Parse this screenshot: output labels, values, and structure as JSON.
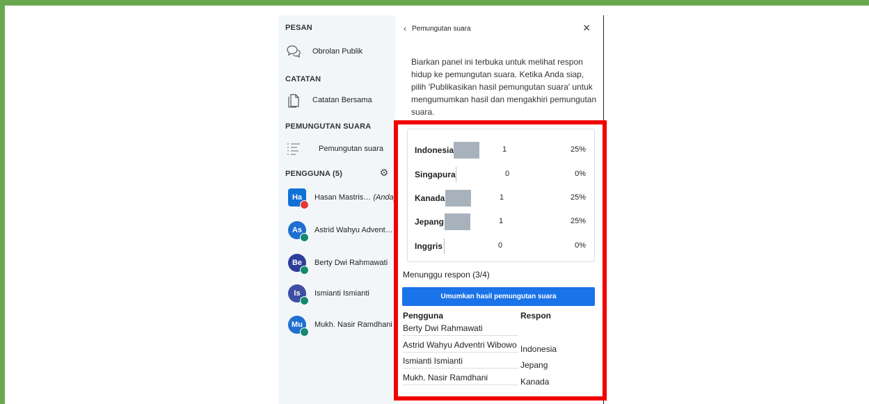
{
  "sidebar": {
    "messages_title": "PESAN",
    "public_chat": "Obrolan Publik",
    "notes_title": "CATATAN",
    "shared_notes": "Catatan Bersama",
    "polling_title": "PEMUNGUTAN SUARA",
    "polling_item": "Pemungutan suara",
    "users_title": "PENGGUNA (5)",
    "users": [
      {
        "initials": "Ha",
        "name": "Hasan Mastris…",
        "suffix": "(Anda)",
        "color": "#0f70d7"
      },
      {
        "initials": "As",
        "name": "Astrid Wahyu Advent…",
        "suffix": "",
        "color": "#1f6fd1"
      },
      {
        "initials": "Be",
        "name": "Berty Dwi Rahmawati",
        "suffix": "",
        "color": "#2c3e9a"
      },
      {
        "initials": "Is",
        "name": "Ismianti Ismianti",
        "suffix": "",
        "color": "#3d4ea3"
      },
      {
        "initials": "Mu",
        "name": "Mukh. Nasir Ramdhani",
        "suffix": "",
        "color": "#1f6fd1"
      }
    ]
  },
  "panel": {
    "back_label": "Pemungutan suara",
    "description": "Biarkan panel ini terbuka untuk melihat respon hidup ke pemungutan suara. Ketika Anda siap, pilih 'Publikasikan hasil pemungutan suara' untuk mengumumkan hasil dan mengakhiri pemungutan suara.",
    "waiting": "Menunggu respon (3/4)",
    "publish_button": "Umumkan hasil pemungutan suara",
    "table_headers": {
      "user": "Pengguna",
      "response": "Respon"
    },
    "responses": [
      {
        "user": "Berty Dwi Rahmawati",
        "response": ""
      },
      {
        "user": "Astrid Wahyu Adventri Wibowo",
        "response": "Indonesia"
      },
      {
        "user": "Ismianti Ismianti",
        "response": "Jepang"
      },
      {
        "user": "Mukh. Nasir Ramdhani",
        "response": "Kanada"
      }
    ]
  },
  "results": [
    {
      "option": "Indonesia",
      "count": "1",
      "percent": "25%",
      "share": 0.25
    },
    {
      "option": "Singapura",
      "count": "0",
      "percent": "0%",
      "share": 0
    },
    {
      "option": "Kanada",
      "count": "1",
      "percent": "25%",
      "share": 0.25
    },
    {
      "option": "Jepang",
      "count": "1",
      "percent": "25%",
      "share": 0.25
    },
    {
      "option": "Inggris",
      "count": "0",
      "percent": "0%",
      "share": 0
    }
  ],
  "colors": {
    "frame": "#6aa84f",
    "highlight": "#f20000",
    "button": "#1a73e8",
    "bar": "#a8b2bc"
  }
}
